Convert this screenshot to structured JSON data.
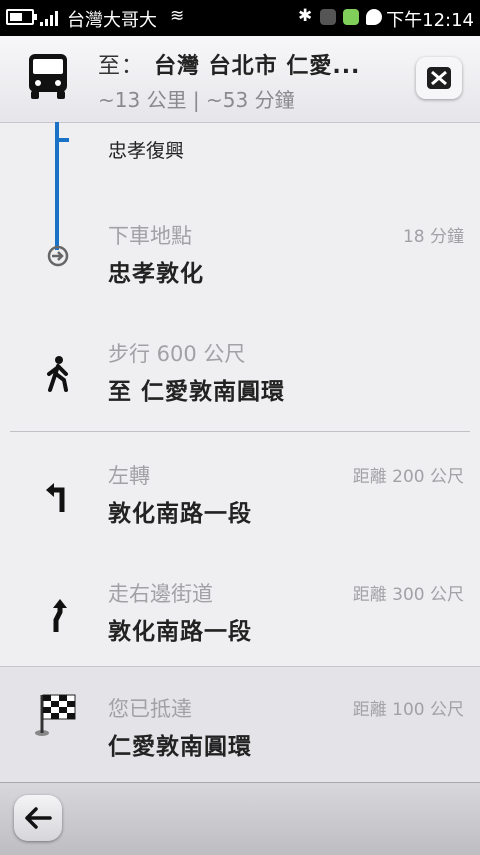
{
  "status_bar": {
    "carrier": "台灣大哥大",
    "time": "下午12:14"
  },
  "header": {
    "dest_prefix": "至：",
    "destination": "台灣 台北市 仁愛...",
    "summary": "~13 公里 | ~53 分鐘"
  },
  "route": {
    "stop_name": "忠孝復興",
    "steps": [
      {
        "title": "下車地點",
        "subtitle": "忠孝敦化",
        "right": "18 分鐘",
        "icon": "alight-icon"
      },
      {
        "title": "步行 600 公尺",
        "subtitle": "至 仁愛敦南圓環",
        "right": "",
        "icon": "walk-icon"
      },
      {
        "title": "左轉",
        "subtitle": "敦化南路一段",
        "right": "距離 200 公尺",
        "icon": "turn-left-icon"
      },
      {
        "title": "走右邊街道",
        "subtitle": "敦化南路一段",
        "right": "距離 300 公尺",
        "icon": "keep-right-icon"
      },
      {
        "title": "您已抵達",
        "subtitle": "仁愛敦南圓環",
        "right": "距離 100 公尺",
        "icon": "checkered-flag-icon"
      }
    ]
  },
  "colors": {
    "transit_line": "#1a72c7",
    "background": "#efeff1"
  }
}
